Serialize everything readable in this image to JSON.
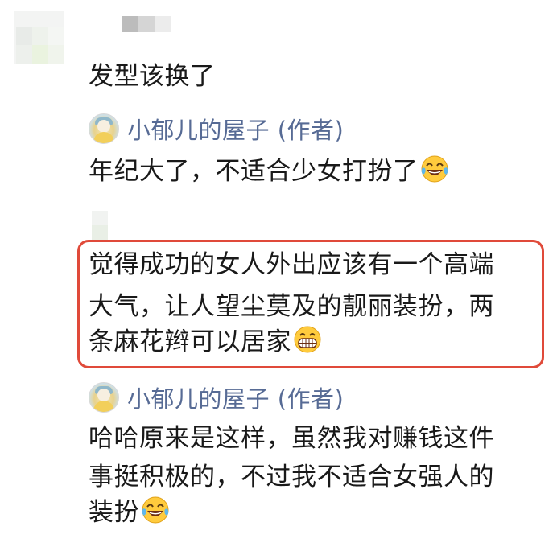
{
  "comments": [
    {
      "author_blurred": true,
      "text": "发型该换了"
    },
    {
      "author": {
        "name": "小郁儿的屋子 (作者)",
        "avatar": "avatar-icon"
      },
      "text": "年纪大了，不适合少女打扮了",
      "emoji": "laughing-tears-emoji"
    },
    {
      "author_blurred": true,
      "highlighted": true,
      "lines": [
        "觉得成功的女人外出应该有一个高端",
        "大气，让人望尘莫及的靓丽装扮，两",
        "条麻花辫可以居家"
      ],
      "emoji": "grinning-teeth-emoji"
    },
    {
      "author": {
        "name": "小郁儿的屋子 (作者)",
        "avatar": "avatar-icon"
      },
      "lines": [
        "哈哈原来是这样，虽然我对赚钱这件",
        "事挺积极的，不过我不适合女强人的",
        "装扮"
      ],
      "emoji": "laughing-tears-emoji"
    }
  ],
  "colors": {
    "author_link": "#576b95",
    "highlight_border": "#e04a3a",
    "text": "#191919"
  }
}
